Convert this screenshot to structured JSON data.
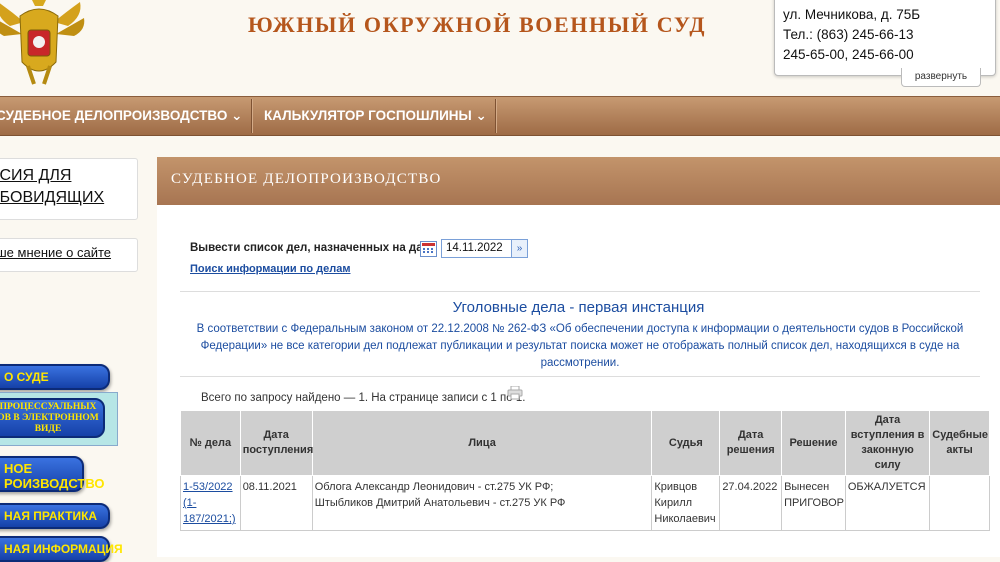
{
  "header": {
    "site_title": "ЮЖНЫЙ ОКРУЖНОЙ ВОЕННЫЙ СУД",
    "contact": {
      "address": "ул. Мечникова, д. 75Б",
      "phone1": "Тел.: (863) 245-66-13",
      "phone2": "245-65-00, 245-66-00",
      "expand_label": "развернуть"
    }
  },
  "nav": {
    "items": [
      {
        "label": "СУДЕБНОЕ ДЕЛОПРОИЗВОДСТВО ⌄"
      },
      {
        "label": "КАЛЬКУЛЯТОР ГОСПОШЛИНЫ ⌄"
      }
    ]
  },
  "sidebar": {
    "vision_line1": "РСИЯ ДЛЯ",
    "vision_line2": "АБОВИДЯЩИХ",
    "opinion_link": "аше мнение о сайте",
    "btn_about": "О СУДЕ",
    "btn_docs_line1": "ПРОЦЕССУАЛЬНЫХ",
    "btn_docs_line2": "ОВ В ЭЛЕКТРОННОМ",
    "btn_docs_line3": "ВИДЕ",
    "btn_proc_line1": "НОЕ",
    "btn_proc_line2": "РОИЗВОДСТВО",
    "btn_practice": "НАЯ ПРАКТИКА",
    "btn_info": "НАЯ ИНФОРМАЦИЯ"
  },
  "content": {
    "heading": "СУДЕБНОЕ ДЕЛОПРОИЗВОДСТВО",
    "date_label": "Вывести список дел, назначенных на дату",
    "date_value": "14.11.2022",
    "search_link": "Поиск информации по делам",
    "cases_title": "Уголовные дела - первая инстанция",
    "law_note": "В соответствии с Федеральным законом от 22.12.2008 № 262-ФЗ «Об обеспечении доступа к информации о деятельности судов в Российской Федерации» не все категории дел подлежат публикации и результат поиска может не отображать полный список дел, находящихся в суде на рассмотрении.",
    "found_text": "Всего по запросу найдено — 1. На странице записи с 1 по 1."
  },
  "table": {
    "headers": {
      "case_no": "№ дела",
      "received": "Дата поступления",
      "persons": "Лица",
      "judge": "Судья",
      "decision_date": "Дата решения",
      "decision": "Решение",
      "effective_date": "Дата вступления в законную силу",
      "acts": "Судебные акты"
    },
    "rows": [
      {
        "case_no": "1-53/2022 (1-187/2021;)",
        "received": "08.11.2021",
        "persons": [
          "Облога Александр Леонидович - ст.275 УК РФ;",
          "Штыбликов Дмитрий Анатольевич - ст.275 УК РФ"
        ],
        "judge": "Кривцов Кирилл Николаевич",
        "decision_date": "27.04.2022",
        "decision": "Вынесен ПРИГОВОР",
        "effective_date": "ОБЖАЛУЕТСЯ",
        "acts": ""
      }
    ]
  },
  "colors": {
    "title": "#b5561c",
    "nav": "#b07d57",
    "link": "#1c4da0",
    "button_blue": "#1541a8",
    "button_text": "#ffe600"
  }
}
